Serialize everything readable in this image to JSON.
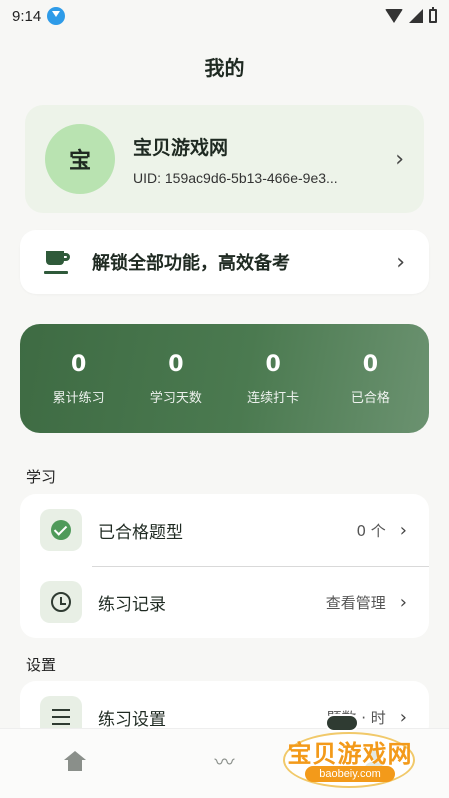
{
  "status": {
    "time": "9:14"
  },
  "page_title": "我的",
  "profile": {
    "avatar_char": "宝",
    "name": "宝贝游戏网",
    "uid": "UID: 159ac9d6-5b13-466e-9e3..."
  },
  "unlock": {
    "text": "解锁全部功能，高效备考"
  },
  "stats": [
    {
      "value": "0",
      "label": "累计练习"
    },
    {
      "value": "0",
      "label": "学习天数"
    },
    {
      "value": "0",
      "label": "连续打卡"
    },
    {
      "value": "0",
      "label": "已合格"
    }
  ],
  "sections": {
    "study": {
      "label": "学习",
      "rows": [
        {
          "title": "已合格题型",
          "value": "0 个"
        },
        {
          "title": "练习记录",
          "value": "查看管理"
        }
      ]
    },
    "settings": {
      "label": "设置",
      "rows": [
        {
          "title": "练习设置",
          "value": "题数 · 时"
        }
      ]
    }
  },
  "chevron": "›",
  "watermark": {
    "text": "宝贝游戏网",
    "url": "baobeiy.com"
  },
  "colors": {
    "accent": "#3e6b43",
    "profile_bg": "#edf3e9",
    "avatar_bg": "#b9e3b1"
  }
}
